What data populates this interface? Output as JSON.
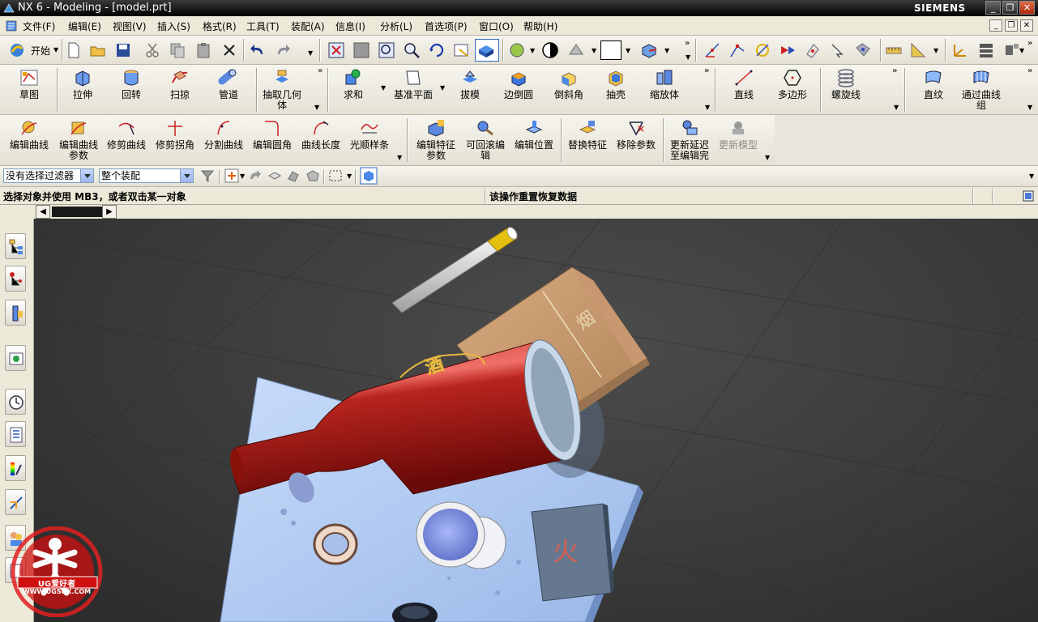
{
  "window": {
    "title": "NX 6 - Modeling - [model.prt]",
    "brand": "SIEMENS"
  },
  "menu": [
    "文件(F)",
    "编辑(E)",
    "视图(V)",
    "插入(S)",
    "格式(R)",
    "工具(T)",
    "装配(A)",
    "信息(I)",
    "分析(L)",
    "首选项(P)",
    "窗口(O)",
    "帮助(H)"
  ],
  "standard": {
    "start_label": "开始"
  },
  "feature_toolbar": {
    "sketch": "草图",
    "extrude": "拉伸",
    "revolve": "回转",
    "sweep": "扫掠",
    "tube": "管道",
    "extract_geometry": "抽取几何体",
    "unite": "求和",
    "datum_plane": "基准平面",
    "draft": "拔模",
    "edge_blend": "边倒圆",
    "chamfer": "倒斜角",
    "shell": "抽壳",
    "scale_body": "缩放体",
    "line": "直线",
    "polygon": "多边形",
    "helix": "螺旋线",
    "ruled": "直纹",
    "through_curves": "通过曲线组"
  },
  "edit_toolbar": {
    "edit_curve": "编辑曲线",
    "edit_curve_params": "编辑曲线参数",
    "trim_curve": "修剪曲线",
    "trim_corner": "修剪拐角",
    "divide_curve": "分割曲线",
    "edit_fillet": "编辑圆角",
    "curve_length": "曲线长度",
    "smooth_spline": "光顺样条",
    "edit_feature_params": "编辑特征参数",
    "rollback_edit": "可回滚编辑",
    "edit_position": "编辑位置",
    "replace_feature": "替换特征",
    "remove_params": "移除参数",
    "update_delayed": "更新延迟至编辑完",
    "update_model": "更新模型"
  },
  "selection": {
    "filter": "没有选择过滤器",
    "scope": "整个装配"
  },
  "status": {
    "prompt": "选择对象并使用 MB3，或者双击某一对象",
    "message": "该操作重置恢复数据"
  },
  "watermark": {
    "brand": "UG爱好者",
    "url": "WWW.UGSNX.COM"
  },
  "colors": {
    "viewport_bg": "#3a3a3a",
    "bottle": "#9c1a14",
    "box": "#c49a6c",
    "plate": "#a8c4f0",
    "label_gold": "#e6b800"
  }
}
